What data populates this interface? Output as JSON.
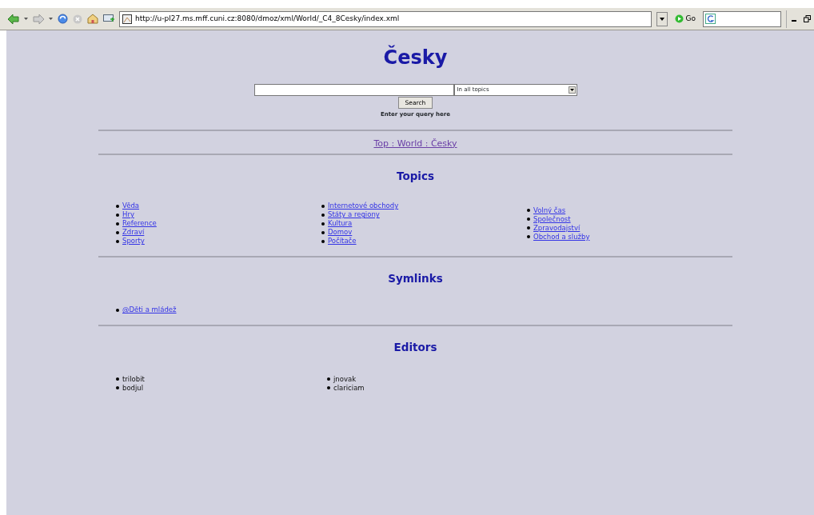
{
  "toolbar": {
    "address": "http://u-pl27.ms.mff.cuni.cz:8080/dmoz/xml/World/_C4_8Cesky/index.xml",
    "go_label": "Go"
  },
  "title": "Česky",
  "search": {
    "scope": "In all topics",
    "button": "Search",
    "hint": "Enter your query here"
  },
  "breadcrumb": "Top : World : Česky",
  "topics": {
    "heading": "Topics",
    "columns": [
      [
        "Věda",
        "Hry",
        "Reference",
        "Zdraví",
        "Sporty"
      ],
      [
        "Internetové obchody",
        "Státy a regiony",
        "Kultura",
        "Domov",
        "Počítače"
      ],
      [
        "Volný čas",
        "Společnost",
        "Zpravodajství",
        "Obchod a služby"
      ]
    ]
  },
  "symlinks": {
    "heading": "Symlinks",
    "columns": [
      [
        "@Děti a mládež"
      ]
    ]
  },
  "editors": {
    "heading": "Editors",
    "columns": [
      [
        "trilobit",
        "bodjul"
      ],
      [
        "jnovak",
        "clariciam"
      ]
    ]
  }
}
